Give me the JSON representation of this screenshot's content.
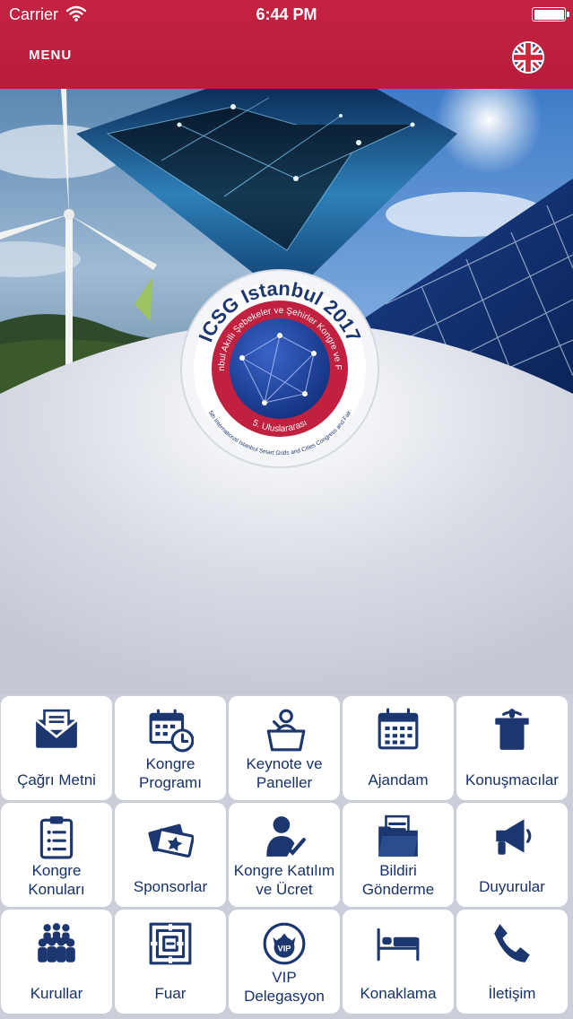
{
  "status_bar": {
    "carrier": "Carrier",
    "time": "6:44 PM",
    "battery": 1.0
  },
  "header": {
    "menu_label": "MENU",
    "language_icon": "uk-flag-icon"
  },
  "logo": {
    "title": "ICSG Istanbul 2017",
    "subtitle_tr": "İstanbul Akıllı Şebekeler ve Şehirler Kongre ve Fuarı",
    "subtitle_num": "5. Uluslararası",
    "subtitle_en": "5th International Istanbul Smart Grids and Cities Congress and Fair"
  },
  "colors": {
    "header": "#c42241",
    "tile_text": "#16306b",
    "icon": "#1c3670",
    "tile_bg": "#ffffff"
  },
  "tiles": [
    {
      "label": "Çağrı Metni",
      "icon": "envelope-icon"
    },
    {
      "label": "Kongre\nProgramı",
      "icon": "calendar-clock-icon"
    },
    {
      "label": "Keynote ve\nPaneller",
      "icon": "speaker-podium-icon"
    },
    {
      "label": "Ajandam",
      "icon": "calendar-icon"
    },
    {
      "label": "Konuşmacılar",
      "icon": "podium-mic-icon"
    },
    {
      "label": "Kongre\nKonuları",
      "icon": "clipboard-icon"
    },
    {
      "label": "Sponsorlar",
      "icon": "tickets-icon"
    },
    {
      "label": "Kongre Katılım\nve Ücret",
      "icon": "person-check-icon"
    },
    {
      "label": "Bildiri\nGönderme",
      "icon": "folder-icon"
    },
    {
      "label": "Duyurular",
      "icon": "megaphone-icon"
    },
    {
      "label": "Kurullar",
      "icon": "group-icon"
    },
    {
      "label": "Fuar",
      "icon": "maze-icon"
    },
    {
      "label": "VIP\nDelegasyon",
      "icon": "vip-icon"
    },
    {
      "label": "Konaklama",
      "icon": "bed-icon"
    },
    {
      "label": "İletişim",
      "icon": "phone-icon"
    }
  ]
}
